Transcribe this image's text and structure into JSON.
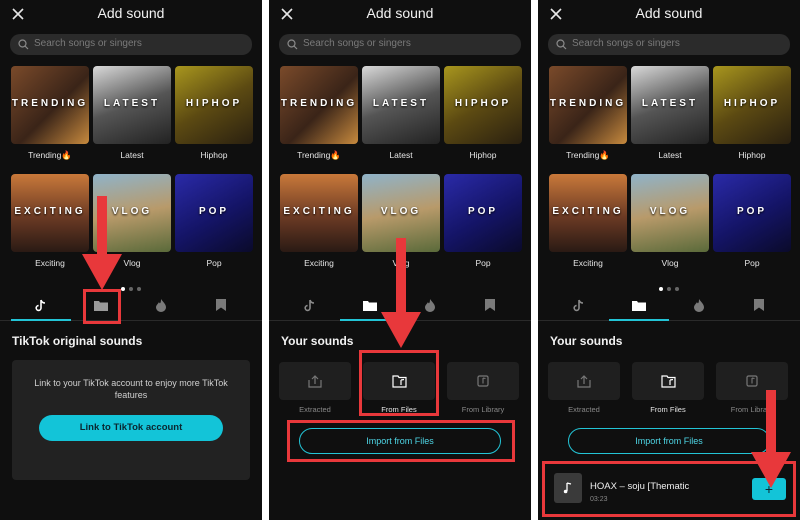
{
  "header": {
    "title": "Add sound"
  },
  "search": {
    "placeholder": "Search songs or singers"
  },
  "categories": [
    {
      "name": "Trending",
      "word": "TRENDING",
      "emoji": "🔥"
    },
    {
      "name": "Latest",
      "word": "LATEST"
    },
    {
      "name": "Hiphop",
      "word": "HIPHOP"
    },
    {
      "name": "Exciting",
      "word": "EXCITING"
    },
    {
      "name": "Vlog",
      "word": "VLOG"
    },
    {
      "name": "Pop",
      "word": "POP"
    }
  ],
  "tiktok": {
    "section_title": "TikTok original sounds",
    "message": "Link to your TikTok account to enjoy more TikTok features",
    "button": "Link to TikTok account"
  },
  "your_sounds": {
    "section_title": "Your sounds",
    "sources": [
      "Extracted",
      "From Files",
      "From Library"
    ],
    "import_button": "Import from Files"
  },
  "track": {
    "name": "HOAX – soju [Thematic",
    "duration": "03:23"
  },
  "colors": {
    "accent": "#13c4d8",
    "highlight": "#e8383b"
  }
}
